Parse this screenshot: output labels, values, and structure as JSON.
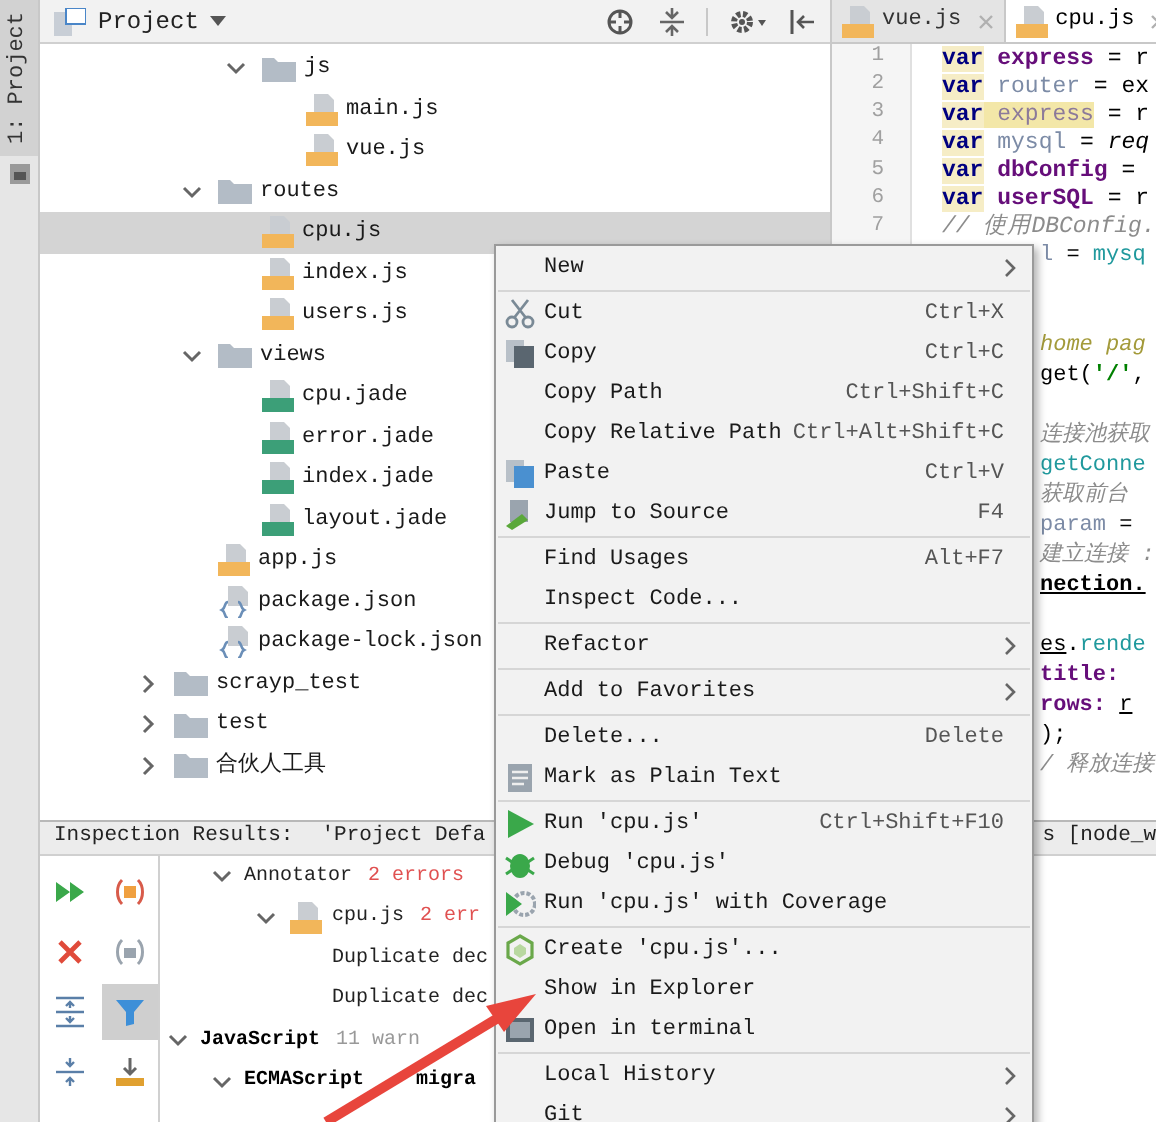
{
  "side_strip": {
    "tab": "1: Project"
  },
  "project": {
    "title": "Project",
    "tree": [
      {
        "children": [
          {
            "children": [
              {
                "label": "js",
                "kind": "folder",
                "expanded": true,
                "selected": false,
                "children": [
                  {
                    "label": "main.js",
                    "kind": "js",
                    "selected": false
                  },
                  {
                    "label": "vue.js",
                    "kind": "js",
                    "selected": false
                  }
                ]
              }
            ]
          },
          {
            "label": "routes",
            "kind": "folder",
            "expanded": true,
            "selected": false,
            "children": [
              {
                "label": "cpu.js",
                "kind": "js",
                "selected": true
              },
              {
                "label": "index.js",
                "kind": "js",
                "selected": false
              },
              {
                "label": "users.js",
                "kind": "js",
                "selected": false
              }
            ]
          },
          {
            "label": "views",
            "kind": "folder",
            "expanded": true,
            "selected": false,
            "children": [
              {
                "label": "cpu.jade",
                "kind": "jade",
                "selected": false
              },
              {
                "label": "error.jade",
                "kind": "jade",
                "selected": false
              },
              {
                "label": "index.jade",
                "kind": "jade",
                "selected": false
              },
              {
                "label": "layout.jade",
                "kind": "jade",
                "selected": false
              }
            ]
          },
          {
            "label": "app.js",
            "kind": "js",
            "selected": false
          },
          {
            "label": "package.json",
            "kind": "json",
            "selected": false
          },
          {
            "label": "package-lock.json",
            "kind": "json",
            "selected": false
          }
        ]
      },
      {
        "label": "scrayp_test",
        "kind": "folder",
        "expanded": false,
        "selected": false
      },
      {
        "label": "test",
        "kind": "folder",
        "expanded": false,
        "selected": false
      },
      {
        "label": "合伙人工具",
        "kind": "folder",
        "expanded": false,
        "selected": false
      }
    ]
  },
  "editor": {
    "tabs": [
      {
        "label": "vue.js",
        "selected": false
      },
      {
        "label": "cpu.js",
        "selected": true
      }
    ],
    "lines": [
      {
        "kind": "full",
        "number": "1",
        "tokens": [
          {
            "t": "var",
            "kind": "kw"
          },
          {
            "t": " express",
            "kind": "var"
          },
          {
            "t": " = r",
            "kind": "plain"
          }
        ]
      },
      {
        "kind": "full",
        "number": "2",
        "tokens": [
          {
            "t": "var",
            "kind": "kw"
          },
          {
            "t": " router",
            "kind": "unused"
          },
          {
            "t": " = ex",
            "kind": "plain"
          }
        ]
      },
      {
        "kind": "full",
        "number": "3",
        "tokens": [
          {
            "t": "var",
            "kind": "kw"
          },
          {
            "t": " express",
            "kind": "dup"
          },
          {
            "t": " = r",
            "kind": "plain"
          }
        ]
      },
      {
        "kind": "full",
        "number": "4",
        "tokens": [
          {
            "t": "var",
            "kind": "kw"
          },
          {
            "t": " mysql",
            "kind": "unused"
          },
          {
            "t": " = ",
            "kind": "plain"
          },
          {
            "t": "req",
            "kind": "italic"
          }
        ]
      },
      {
        "kind": "full",
        "number": "5",
        "tokens": [
          {
            "t": "var",
            "kind": "kw"
          },
          {
            "t": " dbConfig",
            "kind": "var"
          },
          {
            "t": " =",
            "kind": "plain"
          }
        ]
      },
      {
        "kind": "full",
        "number": "6",
        "tokens": [
          {
            "t": "var",
            "kind": "kw"
          },
          {
            "t": " userSQL",
            "kind": "var"
          },
          {
            "t": " = r",
            "kind": "plain"
          }
        ]
      },
      {
        "kind": "full",
        "number": "7",
        "tokens": [
          {
            "t": "// 使用DBConfig.",
            "kind": "comment"
          }
        ]
      },
      {
        "kind": "covered",
        "tokens": [
          {
            "t": "l",
            "kind": "unused"
          },
          {
            "t": " = ",
            "kind": "plain"
          },
          {
            "t": "mysq",
            "kind": "method"
          }
        ]
      },
      {
        "kind": "blank"
      },
      {
        "kind": "blank"
      },
      {
        "kind": "covered",
        "tokens": [
          {
            "t": "home pag",
            "kind": "doc"
          }
        ]
      },
      {
        "kind": "covered",
        "tokens": [
          {
            "t": "get(",
            "kind": "plain"
          },
          {
            "t": "'/'",
            "kind": "string"
          },
          {
            "t": ",",
            "kind": "plain"
          }
        ]
      },
      {
        "kind": "blank"
      },
      {
        "kind": "covered",
        "tokens": [
          {
            "t": "连接池获取",
            "kind": "comment"
          }
        ]
      },
      {
        "kind": "covered",
        "tokens": [
          {
            "t": "getConne",
            "kind": "method"
          }
        ]
      },
      {
        "kind": "covered",
        "tokens": [
          {
            "t": "获取前台",
            "kind": "comment"
          }
        ]
      },
      {
        "kind": "covered",
        "tokens": [
          {
            "t": "param",
            "kind": "unused"
          },
          {
            "t": " =",
            "kind": "plain"
          }
        ]
      },
      {
        "kind": "covered",
        "tokens": [
          {
            "t": "建立连接 :",
            "kind": "comment"
          }
        ]
      },
      {
        "kind": "covered",
        "tokens": [
          {
            "t": "nection.",
            "kind": "boldlink"
          }
        ]
      },
      {
        "kind": "blank"
      },
      {
        "kind": "covered",
        "tokens": [
          {
            "t": "es",
            "kind": "link"
          },
          {
            "t": ".",
            "kind": "plain"
          },
          {
            "t": "rende",
            "kind": "method"
          }
        ]
      },
      {
        "kind": "covered",
        "tokens": [
          {
            "t": "title:",
            "kind": "var"
          }
        ]
      },
      {
        "kind": "covered",
        "tokens": [
          {
            "t": "rows: ",
            "kind": "var"
          },
          {
            "t": "r",
            "kind": "link"
          }
        ]
      },
      {
        "kind": "covered",
        "tokens": [
          {
            "t": ");",
            "kind": "plain"
          }
        ]
      },
      {
        "kind": "covered",
        "tokens": [
          {
            "t": "/ 释放连接",
            "kind": "comment"
          }
        ]
      }
    ]
  },
  "inspection": {
    "title": "Inspection Results:",
    "scope_start": "'Project Defa",
    "scope_end": "s [node_w",
    "tools": [
      {
        "kind": "rerun",
        "selected": false
      },
      {
        "kind": "group-severity",
        "selected": false
      },
      {
        "kind": "close",
        "selected": false
      },
      {
        "kind": "group-dir",
        "selected": false
      },
      {
        "kind": "expand",
        "selected": false
      },
      {
        "kind": "filter",
        "selected": true
      },
      {
        "kind": "collapse",
        "selected": false
      },
      {
        "kind": "export",
        "selected": false
      }
    ],
    "tree": [
      {
        "children": [
          {
            "label": "Annotator",
            "bold": false,
            "count": "2 errors",
            "error": true,
            "children": [
              {
                "label": "cpu.js",
                "file": true,
                "bold": false,
                "count": "2 err",
                "error": true,
                "children": [
                  {
                    "label": "Duplicate dec",
                    "bold": false
                  },
                  {
                    "label": "Duplicate dec",
                    "bold": false
                  }
                ]
              }
            ]
          }
        ]
      },
      {
        "label": "JavaScript",
        "bold": true,
        "count": "11 warn",
        "error": false,
        "children": [
          {
            "label": "ECMAScript",
            "label_end": "migra",
            "bold": true,
            "expanded": true
          }
        ]
      }
    ]
  },
  "context_menu": {
    "groups": [
      [
        {
          "label": "New",
          "kind": "plain",
          "submenu": true
        }
      ],
      [
        {
          "label": "Cut",
          "kind": "cut",
          "shortcut": "Ctrl+X",
          "submenu": false
        },
        {
          "label": "Copy",
          "kind": "copy",
          "shortcut": "Ctrl+C",
          "submenu": false
        },
        {
          "label": "Copy Path",
          "kind": "plain",
          "shortcut": "Ctrl+Shift+C",
          "submenu": false
        },
        {
          "label": "Copy Relative Path",
          "kind": "plain",
          "shortcut": "Ctrl+Alt+Shift+C",
          "submenu": false
        },
        {
          "label": "Paste",
          "kind": "paste",
          "shortcut": "Ctrl+V",
          "submenu": false
        },
        {
          "label": "Jump to Source",
          "kind": "jump",
          "shortcut": "F4",
          "submenu": false
        }
      ],
      [
        {
          "label": "Find Usages",
          "kind": "plain",
          "shortcut": "Alt+F7",
          "submenu": false
        },
        {
          "label": "Inspect Code...",
          "kind": "plain",
          "submenu": false
        }
      ],
      [
        {
          "label": "Refactor",
          "kind": "plain",
          "submenu": true
        }
      ],
      [
        {
          "label": "Add to Favorites",
          "kind": "plain",
          "submenu": true
        }
      ],
      [
        {
          "label": "Delete...",
          "kind": "plain",
          "shortcut": "Delete",
          "submenu": false
        },
        {
          "label": "Mark as Plain Text",
          "kind": "text",
          "submenu": false
        }
      ],
      [
        {
          "label": "Run 'cpu.js'",
          "kind": "run",
          "shortcut": "Ctrl+Shift+F10",
          "submenu": false
        },
        {
          "label": "Debug 'cpu.js'",
          "kind": "debug",
          "submenu": false
        },
        {
          "label": "Run 'cpu.js' with Coverage",
          "kind": "coverage",
          "submenu": false
        }
      ],
      [
        {
          "label": "Create 'cpu.js'...",
          "kind": "node",
          "submenu": false
        },
        {
          "label": "Show in Explorer",
          "kind": "plain",
          "submenu": false
        },
        {
          "label": "Open in terminal",
          "kind": "terminal",
          "submenu": false
        }
      ],
      [
        {
          "label": "Local History",
          "kind": "plain",
          "submenu": true
        },
        {
          "label": "Git",
          "kind": "plain",
          "submenu": true
        }
      ]
    ]
  },
  "annotation": {
    "kind": "arrow"
  }
}
